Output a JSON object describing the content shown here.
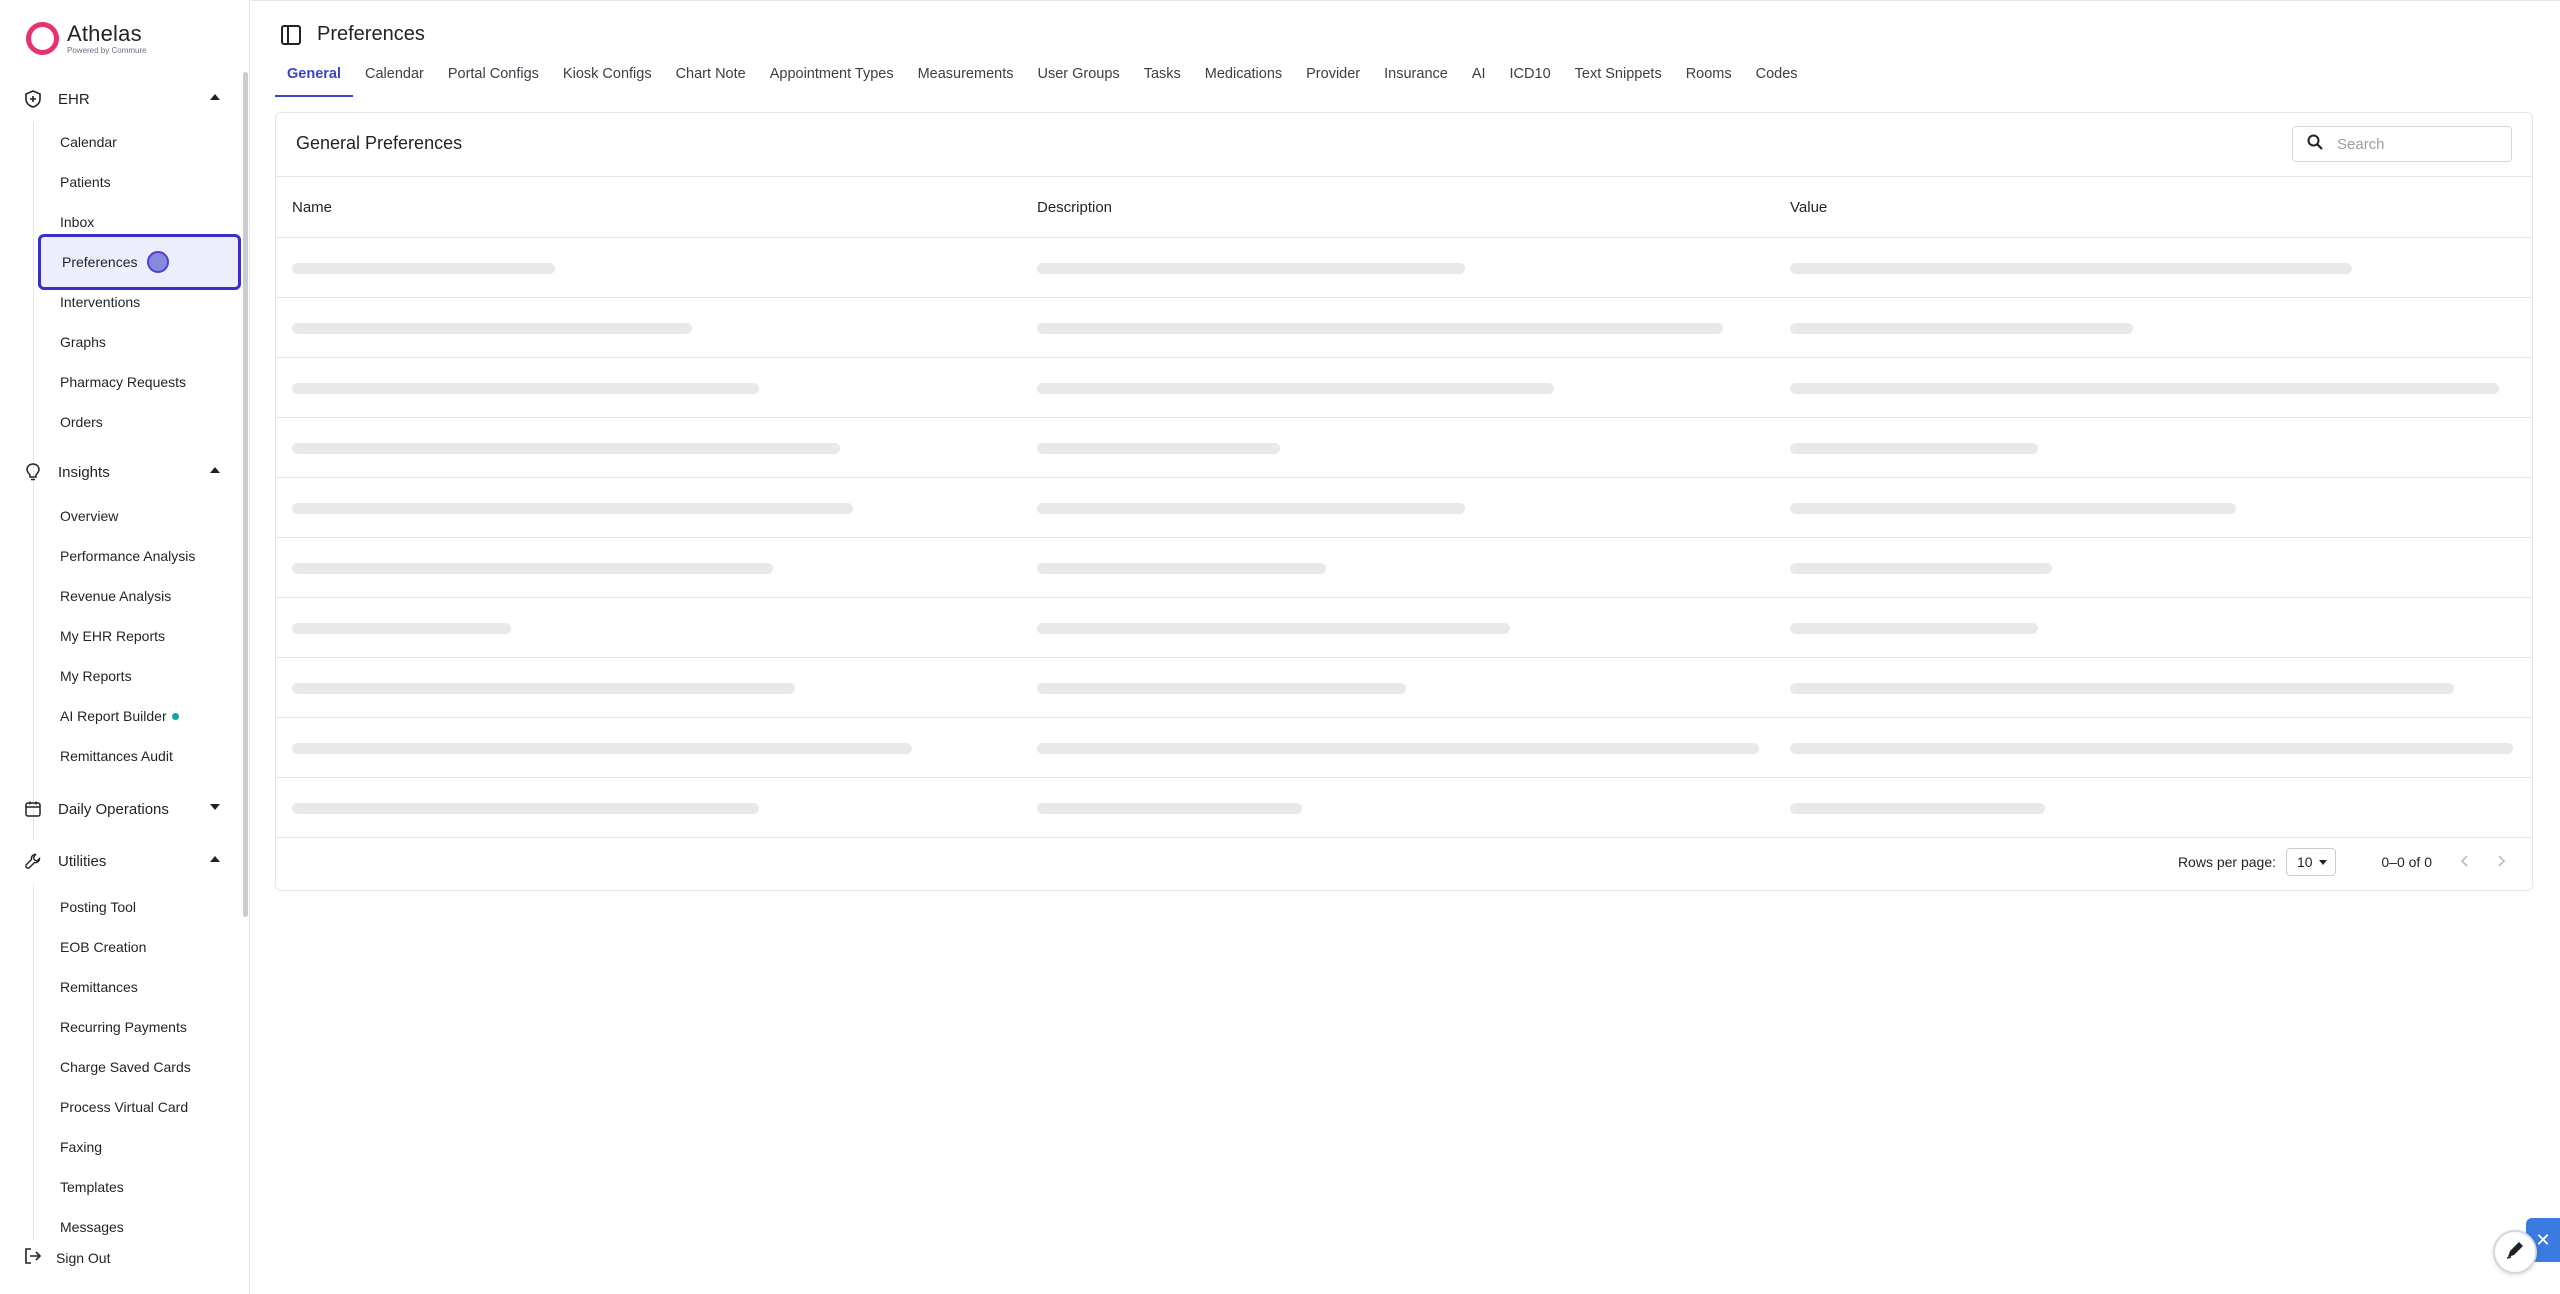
{
  "brand": {
    "name": "Athelas",
    "sub": "Powered by Commure"
  },
  "sidebar": {
    "sections": [
      {
        "label": "EHR",
        "expanded": true,
        "icon": "shield-icon"
      },
      {
        "label": "Insights",
        "expanded": true,
        "icon": "lightbulb-icon"
      },
      {
        "label": "Daily Operations",
        "expanded": false,
        "icon": "calendar-icon"
      },
      {
        "label": "Utilities",
        "expanded": true,
        "icon": "wrench-icon"
      }
    ],
    "ehr_items": [
      "Calendar",
      "Patients",
      "Inbox",
      "Preferences",
      "Interventions",
      "Graphs",
      "Pharmacy Requests",
      "Orders"
    ],
    "insights_items": [
      "Overview",
      "Performance Analysis",
      "Revenue Analysis",
      "My EHR Reports",
      "My Reports",
      "AI Report Builder",
      "Remittances Audit"
    ],
    "utilities_items": [
      "Posting Tool",
      "EOB Creation",
      "Remittances",
      "Recurring Payments",
      "Charge Saved Cards",
      "Process Virtual Card",
      "Faxing",
      "Templates",
      "Messages"
    ],
    "active_item": "Preferences",
    "sign_out": "Sign Out"
  },
  "header": {
    "title": "Preferences"
  },
  "tabs": [
    "General",
    "Calendar",
    "Portal Configs",
    "Kiosk Configs",
    "Chart Note",
    "Appointment Types",
    "Measurements",
    "User Groups",
    "Tasks",
    "Medications",
    "Provider",
    "Insurance",
    "AI",
    "ICD10",
    "Text Snippets",
    "Rooms",
    "Codes"
  ],
  "active_tab": "General",
  "card": {
    "title": "General Preferences",
    "search_placeholder": "Search",
    "columns": [
      "Name",
      "Description",
      "Value"
    ],
    "loading_rows": 10
  },
  "footer": {
    "rows_per_page_label": "Rows per page:",
    "rows_per_page_value": "10",
    "range": "0–0 of 0"
  },
  "colors": {
    "accent": "#3a45c7",
    "brand": "#e6336b",
    "active_border": "#3a2fc7",
    "new_dot": "#11a4a6"
  }
}
